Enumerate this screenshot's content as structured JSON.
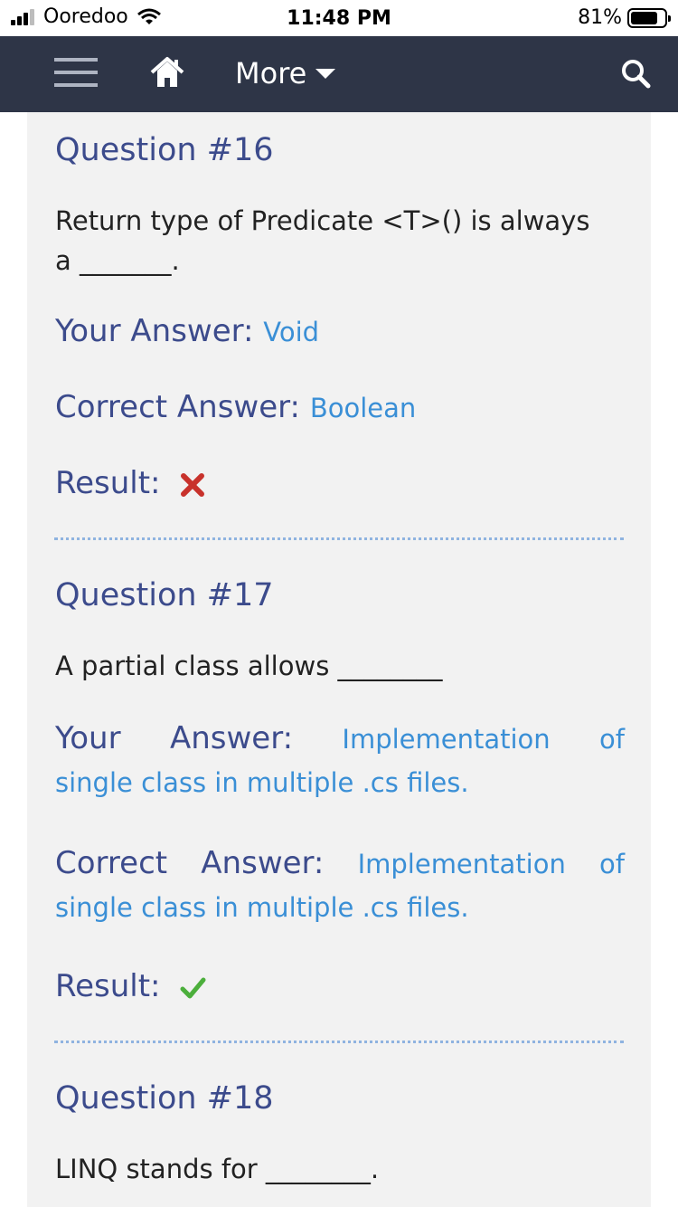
{
  "status": {
    "carrier": "Ooredoo",
    "time": "11:48 PM",
    "battery": "81%",
    "battery_level": 0.81
  },
  "nav": {
    "more_label": "More"
  },
  "questions": [
    {
      "title": "Question #16",
      "text_line1": "Return type of Predicate <T>() is always",
      "text_line2": "a _______.",
      "your_label": "Your Answer:",
      "your_value": "Void",
      "correct_label": "Correct Answer:",
      "correct_value": "Boolean",
      "result_label": "Result:",
      "result": "wrong"
    },
    {
      "title": "Question #17",
      "text_line1": "A partial class allows ________",
      "your_label_a": "Your",
      "your_label_b": "Answer:",
      "your_value_a": "Implementation",
      "your_value_b": "of",
      "your_value_line2": "single class in multiple .cs files.",
      "correct_label_a": "Correct",
      "correct_label_b": "Answer:",
      "correct_value_a": "Implementation",
      "correct_value_b": "of",
      "correct_value_line2": "single class in multiple .cs files.",
      "result_label": "Result:",
      "result": "correct"
    },
    {
      "title": "Question #18",
      "text_line1": "LINQ stands for ________."
    }
  ]
}
